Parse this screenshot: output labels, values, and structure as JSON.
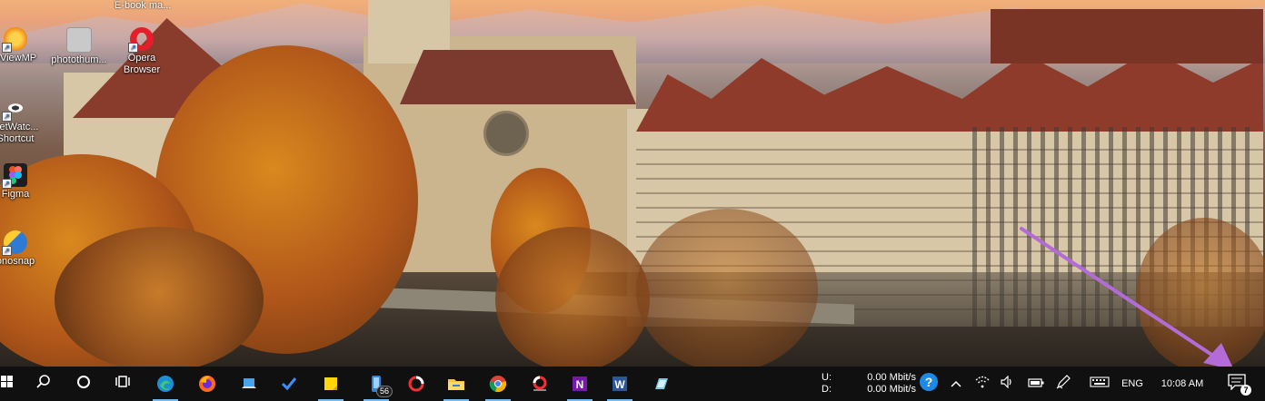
{
  "desktop": {
    "partial_title": "E-book ma...",
    "icons": [
      {
        "label_line1": "nViewMP",
        "label_line2": "",
        "icon": "sun-app-icon"
      },
      {
        "label_line1": "photothum...",
        "label_line2": "",
        "icon": "photo-file-icon"
      },
      {
        "label_line1": "Opera",
        "label_line2": "Browser",
        "icon": "opera-icon"
      },
      {
        "label_line1": "NetWatc...",
        "label_line2": "Shortcut",
        "icon": "netwatch-eye-icon"
      },
      {
        "label_line1": "Figma",
        "label_line2": "",
        "icon": "figma-icon"
      },
      {
        "label_line1": "onosnap",
        "label_line2": "",
        "icon": "monosnap-icon"
      }
    ]
  },
  "taskbar": {
    "apps": [
      {
        "name": "start",
        "icon": "windows-icon"
      },
      {
        "name": "search",
        "icon": "search-icon"
      },
      {
        "name": "cortana",
        "icon": "cortana-circle-icon"
      },
      {
        "name": "task-view",
        "icon": "task-view-icon"
      },
      {
        "name": "edge",
        "icon": "edge-icon"
      },
      {
        "name": "firefox",
        "icon": "firefox-icon"
      },
      {
        "name": "connect",
        "icon": "laptop-icon"
      },
      {
        "name": "todo",
        "icon": "checkmark-icon"
      },
      {
        "name": "sticky-notes",
        "icon": "sticky-note-icon"
      },
      {
        "name": "phone",
        "icon": "phone-icon",
        "badge": "56"
      },
      {
        "name": "circle-app",
        "icon": "ring-icon"
      },
      {
        "name": "file-explorer",
        "icon": "folder-icon"
      },
      {
        "name": "chrome",
        "icon": "chrome-icon"
      },
      {
        "name": "photo-app",
        "icon": "photo-ring-icon"
      },
      {
        "name": "onenote",
        "icon": "onenote-icon"
      },
      {
        "name": "word",
        "icon": "word-icon"
      },
      {
        "name": "snip",
        "icon": "snip-icon"
      }
    ],
    "tray": {
      "net_up_label": "U:",
      "net_down_label": "D:",
      "net_up_value": "0.00 Mbit/s",
      "net_down_value": "0.00 Mbit/s",
      "language": "ENG",
      "time": "10:08 AM",
      "notifications_count": "7"
    }
  },
  "colors": {
    "taskbar_bg": "#101010",
    "accent": "#76b9ed",
    "annotation_arrow": "#b36bd8"
  }
}
